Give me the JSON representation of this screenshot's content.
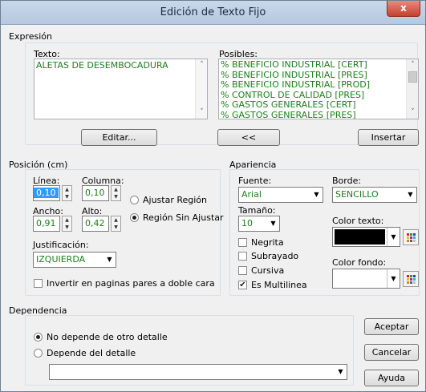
{
  "window": {
    "title": "Edición de Texto Fijo",
    "close_label": "x"
  },
  "expresion": {
    "group_label": "Expresión",
    "texto_label": "Texto:",
    "texto_value": "ALETAS DE DESEMBOCADURA",
    "posibles_label": "Posibles:",
    "posibles_items": [
      "% BENEFICIO INDUSTRIAL [CERT]",
      "% BENEFICIO INDUSTRIAL [PRES]",
      "% BENEFICIO INDUSTRIAL [PROD]",
      "% CONTROL DE CALIDAD [PRES]",
      "% GASTOS GENERALES [CERT]",
      "% GASTOS GENERALES [PRES]"
    ],
    "editar_label": "Editar...",
    "back_label": "<<",
    "insertar_label": "Insertar"
  },
  "posicion": {
    "group_label": "Posición (cm)",
    "linea_label": "Línea:",
    "linea_value": "0,10",
    "columna_label": "Columna:",
    "columna_value": "0,10",
    "ancho_label": "Ancho:",
    "ancho_value": "0,91",
    "alto_label": "Alto:",
    "alto_value": "0,42",
    "ajustar_label": "Ajustar Región",
    "sin_ajustar_label": "Región Sin Ajustar",
    "justificacion_label": "Justificación:",
    "justificacion_value": "IZQUIERDA",
    "invertir_label": "Invertir en paginas pares a doble cara"
  },
  "apariencia": {
    "group_label": "Apariencia",
    "fuente_label": "Fuente:",
    "fuente_value": "Arial",
    "borde_label": "Borde:",
    "borde_value": "SENCILLO",
    "tamano_label": "Tamaño:",
    "tamano_value": "10",
    "negrita_label": "Negrita",
    "subrayado_label": "Subrayado",
    "cursiva_label": "Cursiva",
    "multilinea_label": "Es Multilinea",
    "color_texto_label": "Color texto:",
    "color_texto_value": "#000000",
    "color_fondo_label": "Color fondo:",
    "color_fondo_value": "#ffffff"
  },
  "dependencia": {
    "group_label": "Dependencia",
    "no_depende_label": "No depende de otro detalle",
    "depende_label": "Depende del detalle",
    "detalle_value": ""
  },
  "buttons": {
    "aceptar": "Aceptar",
    "cancelar": "Cancelar",
    "ayuda": "Ayuda"
  }
}
